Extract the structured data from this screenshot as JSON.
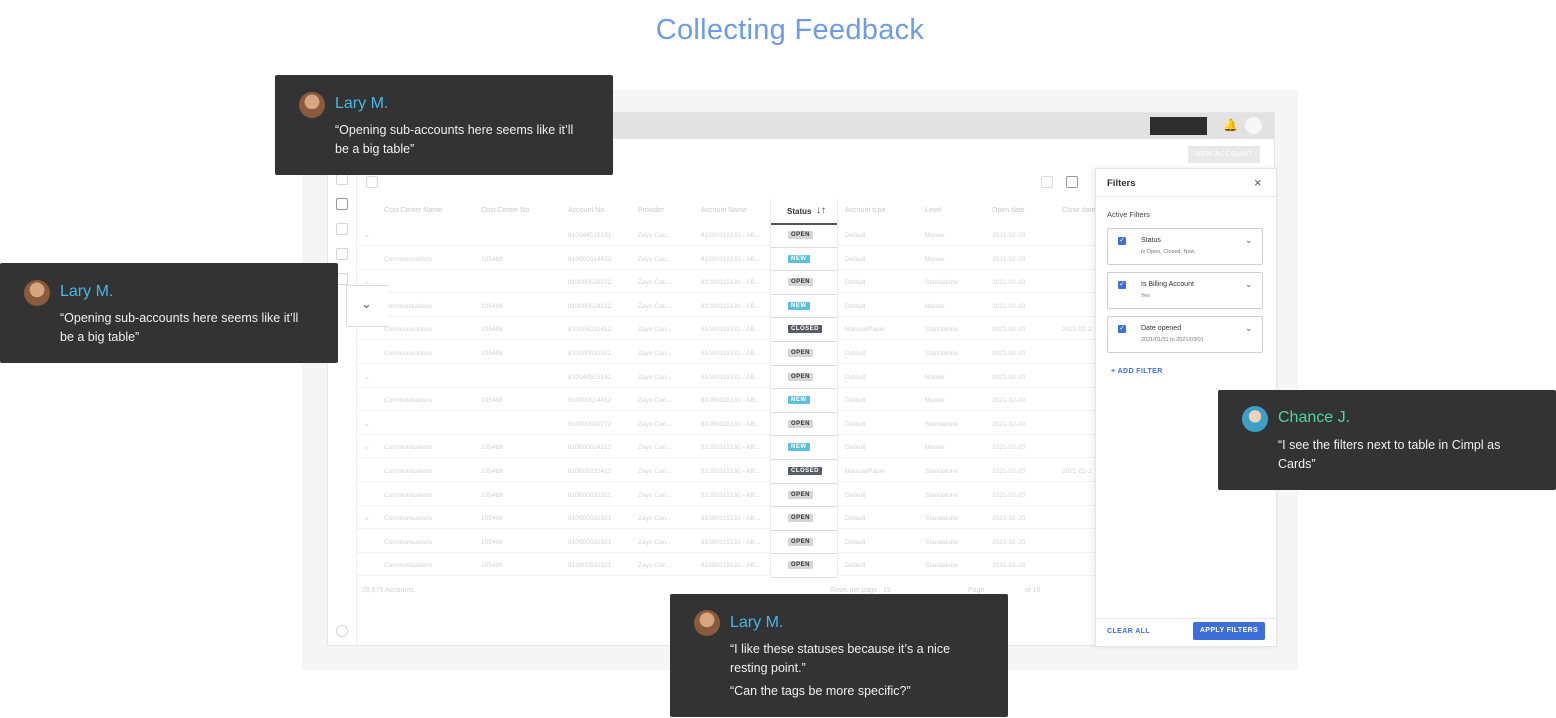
{
  "page": {
    "title": "Collecting Feedback"
  },
  "app": {
    "new_account_label": "NEW ACCOUNT",
    "table": {
      "headers": [
        "Cost Center Name",
        "Cost Center No.",
        "Account No.",
        "Provider",
        "Account Name",
        "Status",
        "Account type",
        "Level",
        "Open date",
        "Close date"
      ],
      "rows": [
        {
          "cc_name": "",
          "cc_no": "",
          "acc_no": "810044515191",
          "provider": "Zayo Can...",
          "acc_name": "81000315131 - AB...",
          "status": "OPEN",
          "type": "Default",
          "level": "Master",
          "open": "2021-02-20",
          "close": ""
        },
        {
          "cc_name": "Communications",
          "cc_no": "105488",
          "acc_no": "810000514432",
          "provider": "Zayo Can...",
          "acc_name": "81000315131 - AB...",
          "status": "NEW",
          "type": "Default",
          "level": "Master",
          "open": "2021-02-20",
          "close": ""
        },
        {
          "cc_name": "",
          "cc_no": "",
          "acc_no": "810000530272",
          "provider": "Zayo Can...",
          "acc_name": "81000315131 - AB...",
          "status": "OPEN",
          "type": "Default",
          "level": "Standalone",
          "open": "2021-02-20",
          "close": ""
        },
        {
          "cc_name": "Communications",
          "cc_no": "105488",
          "acc_no": "810000524212",
          "provider": "Zayo Can...",
          "acc_name": "81000315131 - AB...",
          "status": "NEW",
          "type": "Default",
          "level": "Master",
          "open": "2021-02-20",
          "close": ""
        },
        {
          "cc_name": "Communications",
          "cc_no": "105488",
          "acc_no": "810005232412",
          "provider": "Zayo Can...",
          "acc_name": "81000315131 - AB...",
          "status": "CLOSED",
          "type": "Manual/Paper",
          "level": "Standalone",
          "open": "2021-02-20",
          "close": "2021-02-2"
        },
        {
          "cc_name": "Communications",
          "cc_no": "105488",
          "acc_no": "810000532321",
          "provider": "Zayo Can...",
          "acc_name": "81000315131 - AB...",
          "status": "OPEN",
          "type": "Default",
          "level": "Standalone",
          "open": "2021-02-20",
          "close": ""
        },
        {
          "cc_name": "",
          "cc_no": "",
          "acc_no": "810044515191",
          "provider": "Zayo Can...",
          "acc_name": "81000315131 - AB...",
          "status": "OPEN",
          "type": "Default",
          "level": "Master",
          "open": "2021-02-20",
          "close": ""
        },
        {
          "cc_name": "Communications",
          "cc_no": "105488",
          "acc_no": "810000514432",
          "provider": "Zayo Can...",
          "acc_name": "81000315131 - AB...",
          "status": "NEW",
          "type": "Default",
          "level": "Master",
          "open": "2021-02-20",
          "close": ""
        },
        {
          "cc_name": "",
          "cc_no": "",
          "acc_no": "810000530272",
          "provider": "Zayo Can...",
          "acc_name": "81000315131 - AB...",
          "status": "OPEN",
          "type": "Default",
          "level": "Standalone",
          "open": "2021-02-20",
          "close": ""
        },
        {
          "cc_name": "Communications",
          "cc_no": "105488",
          "acc_no": "810000524212",
          "provider": "Zayo Can...",
          "acc_name": "81000315131 - AB...",
          "status": "NEW",
          "type": "Default",
          "level": "Master",
          "open": "2021-02-20",
          "close": ""
        },
        {
          "cc_name": "Communications",
          "cc_no": "105488",
          "acc_no": "810005232412",
          "provider": "Zayo Can...",
          "acc_name": "81000315131 - AB...",
          "status": "CLOSED",
          "type": "Manual/Paper",
          "level": "Standalone",
          "open": "2021-02-20",
          "close": "2021-02-2"
        },
        {
          "cc_name": "Communications",
          "cc_no": "105488",
          "acc_no": "810000532321",
          "provider": "Zayo Can...",
          "acc_name": "81000315131 - AB...",
          "status": "OPEN",
          "type": "Default",
          "level": "Standalone",
          "open": "2021-02-20",
          "close": ""
        },
        {
          "cc_name": "Communications",
          "cc_no": "105488",
          "acc_no": "810000532321",
          "provider": "Zayo Can...",
          "acc_name": "81000315131 - AB...",
          "status": "OPEN",
          "type": "Default",
          "level": "Standalone",
          "open": "2021-02-20",
          "close": ""
        },
        {
          "cc_name": "Communications",
          "cc_no": "105488",
          "acc_no": "810000532321",
          "provider": "Zayo Can...",
          "acc_name": "81000315131 - AB...",
          "status": "OPEN",
          "type": "Default",
          "level": "Standalone",
          "open": "2021-02-20",
          "close": ""
        },
        {
          "cc_name": "Communications",
          "cc_no": "105488",
          "acc_no": "810000532321",
          "provider": "Zayo Can...",
          "acc_name": "81000315131 - AB...",
          "status": "OPEN",
          "type": "Default",
          "level": "Standalone",
          "open": "2021-02-20",
          "close": ""
        }
      ],
      "footer": {
        "count": "28,875 Accounts",
        "rows_per_page": "Rows per page",
        "rows_value": "15",
        "page_label": "Page",
        "page_of": "of 16"
      }
    }
  },
  "filters": {
    "title": "Filters",
    "active_label": "Active Filters",
    "items": [
      {
        "title": "Status",
        "subtitle": "Is Open, Closed, New"
      },
      {
        "title": "Is Billing Account",
        "subtitle": "Yes"
      },
      {
        "title": "Date opened",
        "subtitle": "2021/01/31 to 2021/03/01"
      }
    ],
    "add_filter": "ADD FILTER",
    "clear_all": "CLEAR ALL",
    "apply": "APPLY FILTERS"
  },
  "feedback": [
    {
      "name": "Lary M.",
      "quotes": [
        "“Opening sub-accounts here seems like it’ll",
        "be a big table”"
      ]
    },
    {
      "name": "Lary M.",
      "quotes": [
        "“Opening sub-accounts here seems like it’ll",
        "be a big table”"
      ]
    },
    {
      "name": "Chance J.",
      "quotes": [
        "“I see the filters next to table in Cimpl as",
        "Cards”"
      ]
    },
    {
      "name": "Lary M.",
      "quotes": [
        "“I like these statuses because it’s a nice",
        "resting point.”",
        "“Can the tags be more specific?”"
      ]
    }
  ],
  "colors": {
    "title": "#6c9be8",
    "card_bg": "#333333",
    "name_blue": "#45b8e9",
    "name_green": "#49d9a5",
    "primary": "#3c6fd8",
    "tag_new": "#5bc0de",
    "tag_closed": "#555c66"
  }
}
